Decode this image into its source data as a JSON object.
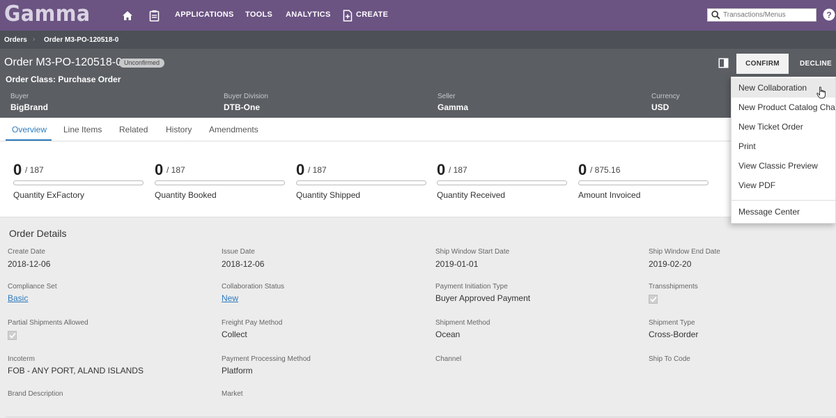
{
  "app": {
    "logo": "Gamma"
  },
  "nav": {
    "home_icon": "home-icon",
    "clipboard_icon": "clipboard-icon",
    "links": [
      "APPLICATIONS",
      "TOOLS",
      "ANALYTICS"
    ],
    "create_label": "CREATE",
    "search_placeholder": "Transactions/Menus",
    "help_icon": "help-circle-icon"
  },
  "breadcrumb": [
    "Orders",
    "Order M3-PO-120518-0"
  ],
  "order": {
    "title": "Order M3-PO-120518-0",
    "status": "Unconfirmed",
    "class_line": "Order Class: Purchase Order",
    "fields": [
      {
        "label": "Buyer",
        "value": "BigBrand"
      },
      {
        "label": "Buyer Division",
        "value": "DTB-One"
      },
      {
        "label": "Seller",
        "value": "Gamma"
      },
      {
        "label": "Currency",
        "value": "USD"
      }
    ],
    "confirm_label": "CONFIRM",
    "decline_label": "DECLINE"
  },
  "tabs": [
    "Overview",
    "Line Items",
    "Related",
    "History",
    "Amendments"
  ],
  "active_tab": "Overview",
  "stats": [
    {
      "value": "0",
      "total": "/ 187",
      "label": "Quantity ExFactory",
      "progress": 0
    },
    {
      "value": "0",
      "total": "/ 187",
      "label": "Quantity Booked",
      "progress": 0
    },
    {
      "value": "0",
      "total": "/ 187",
      "label": "Quantity Shipped",
      "progress": 0
    },
    {
      "value": "0",
      "total": "/ 187",
      "label": "Quantity Received",
      "progress": 0
    },
    {
      "value": "0",
      "total": "/ 875.16",
      "label": "Amount Invoiced",
      "progress": 0
    }
  ],
  "details": {
    "title": "Order Details",
    "create_date": {
      "label": "Create Date",
      "value": "2018-12-06"
    },
    "issue_date": {
      "label": "Issue Date",
      "value": "2018-12-06"
    },
    "ship_start": {
      "label": "Ship Window Start Date",
      "value": "2019-01-01"
    },
    "ship_end": {
      "label": "Ship Window End Date",
      "value": "2019-02-20"
    },
    "compliance_set": {
      "label": "Compliance Set",
      "value": "Basic"
    },
    "collab_status": {
      "label": "Collaboration Status",
      "value": "New"
    },
    "payment_init": {
      "label": "Payment Initiation Type",
      "value": "Buyer Approved Payment"
    },
    "transshipments": {
      "label": "Transshipments",
      "checked": true
    },
    "partial_shipments": {
      "label": "Partial Shipments Allowed",
      "checked": true
    },
    "freight_pay": {
      "label": "Freight Pay Method",
      "value": "Collect"
    },
    "shipment_method": {
      "label": "Shipment Method",
      "value": "Ocean"
    },
    "shipment_type": {
      "label": "Shipment Type",
      "value": "Cross-Border"
    },
    "incoterm": {
      "label": "Incoterm",
      "value": "FOB - ANY PORT, ALAND ISLANDS"
    },
    "payment_processing": {
      "label": "Payment Processing Method",
      "value": "Platform"
    },
    "channel": {
      "label": "Channel",
      "value": ""
    },
    "ship_to_code": {
      "label": "Ship To Code",
      "value": ""
    },
    "brand_description": {
      "label": "Brand Description",
      "value": ""
    },
    "market": {
      "label": "Market",
      "value": ""
    }
  },
  "menu": {
    "items": [
      "New Collaboration",
      "New Product Catalog Chan",
      "New Ticket Order",
      "Print",
      "View Classic Preview",
      "View PDF"
    ],
    "footer_item": "Message Center",
    "hovered": "New Collaboration"
  },
  "colors": {
    "nav_bg": "#6b5382",
    "header_bg": "#5b5e63",
    "accent": "#2e7bbd"
  }
}
